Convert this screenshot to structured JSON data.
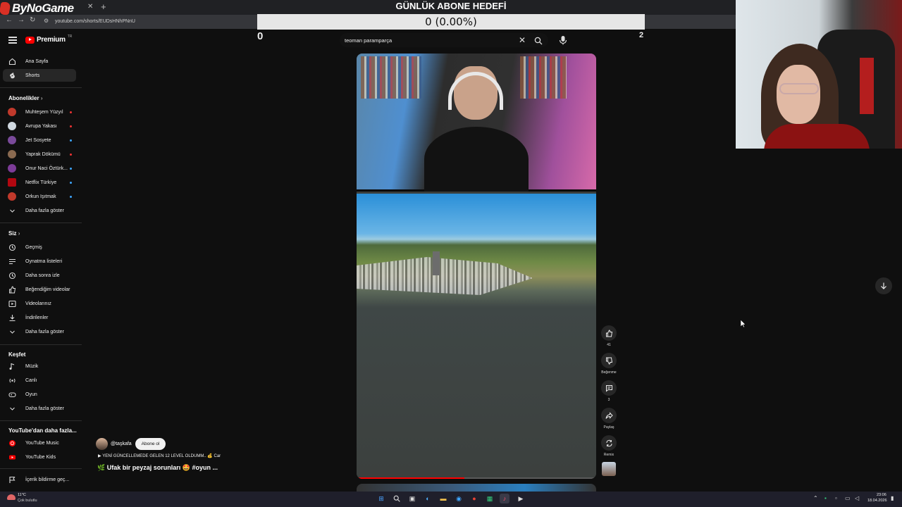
{
  "browser": {
    "brand": "ByNoGame",
    "url": "youtube.com/shorts/EUDsHNhPNnU"
  },
  "goal": {
    "title": "GÜNLÜK ABONE HEDEFİ",
    "value": "0 (0.00%)",
    "start": "0",
    "target": "2"
  },
  "header": {
    "logo_text": "Premium",
    "region": "TR",
    "search_value": "teoman paramparça"
  },
  "sidebar": {
    "main": [
      {
        "label": "Ana Sayfa",
        "icon": "home-icon"
      },
      {
        "label": "Shorts",
        "icon": "shorts-icon"
      }
    ],
    "subscriptions_title": "Abonelikler",
    "subscriptions": [
      {
        "label": "Muhteşem Yüzyıl",
        "color": "#c0392b",
        "live": "#e33"
      },
      {
        "label": "Avrupa Yakası",
        "color": "#d0d8e0",
        "live": "#e33"
      },
      {
        "label": "Jet Sosyete",
        "color": "#7a4a9a",
        "live": "#3ea6ff"
      },
      {
        "label": "Yaprak Dökümü",
        "color": "#8a6a50",
        "live": "#e33"
      },
      {
        "label": "Onur Naci Öztürk...",
        "color": "#7d3c98",
        "live": "#3ea6ff"
      },
      {
        "label": "Netflix Türkiye",
        "color": "#b20710",
        "live": "#3ea6ff"
      },
      {
        "label": "Orkun Işıtmak",
        "color": "#c0392b",
        "live": "#3ea6ff"
      }
    ],
    "subscriptions_more": "Daha fazla göster",
    "you_title": "Siz",
    "you": [
      {
        "label": "Geçmiş",
        "icon": "history-icon"
      },
      {
        "label": "Oynatma listeleri",
        "icon": "playlists-icon"
      },
      {
        "label": "Daha sonra izle",
        "icon": "watch-later-icon"
      },
      {
        "label": "Beğendiğim videolar",
        "icon": "liked-icon"
      },
      {
        "label": "Videolarınız",
        "icon": "your-videos-icon"
      },
      {
        "label": "İndirilenler",
        "icon": "downloads-icon"
      }
    ],
    "you_more": "Daha fazla göster",
    "explore_title": "Keşfet",
    "explore": [
      {
        "label": "Müzik",
        "icon": "music-icon"
      },
      {
        "label": "Canlı",
        "icon": "live-icon"
      },
      {
        "label": "Oyun",
        "icon": "gaming-icon"
      }
    ],
    "explore_more": "Daha fazla göster",
    "more_title": "YouTube'dan daha fazla...",
    "more": [
      {
        "label": "YouTube Music",
        "icon": "youtube-music-icon"
      },
      {
        "label": "YouTube Kids",
        "icon": "youtube-kids-icon"
      }
    ],
    "report": "İçerik bildirme geç..."
  },
  "short": {
    "channel": "@taşkafa",
    "subscribe": "Abone ol",
    "music": "YENİ GÜNCELLEMEDE GELEN 12 LEVEL OLDUMM.. 💰 Car",
    "title": "Ufak bir peyzaj sorunları 🤩 #oyun ...",
    "progress": 0.45,
    "likes": "41",
    "dislike_label": "Beğenme",
    "comments": "3",
    "share_label": "Paylaş",
    "remix_label": "Remix"
  },
  "taskbar": {
    "temp": "11°C",
    "weather": "Çok bulutlu",
    "time": "23:06",
    "date": "18.04.2026"
  },
  "colors": {
    "accent": "#ff0000",
    "background": "#0f0f0f"
  }
}
